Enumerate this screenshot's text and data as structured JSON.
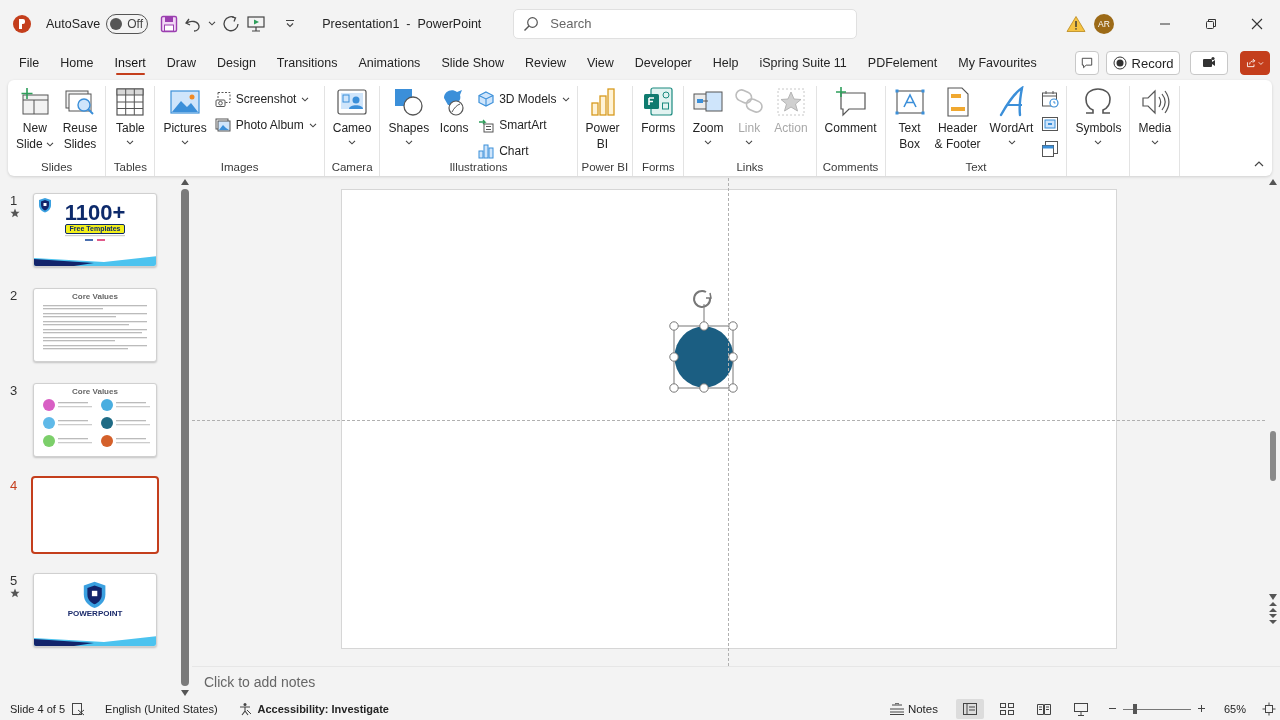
{
  "title_bar": {
    "autosave": {
      "label": "AutoSave",
      "state_text": "Off",
      "on": false
    },
    "document_title": "Presentation1  -  PowerPoint",
    "search": {
      "placeholder": "Search"
    },
    "account": {
      "initials": "AR"
    }
  },
  "tabs": [
    {
      "label": "File",
      "selected": false
    },
    {
      "label": "Home",
      "selected": false
    },
    {
      "label": "Insert",
      "selected": true
    },
    {
      "label": "Draw",
      "selected": false
    },
    {
      "label": "Design",
      "selected": false
    },
    {
      "label": "Transitions",
      "selected": false
    },
    {
      "label": "Animations",
      "selected": false
    },
    {
      "label": "Slide Show",
      "selected": false
    },
    {
      "label": "Review",
      "selected": false
    },
    {
      "label": "View",
      "selected": false
    },
    {
      "label": "Developer",
      "selected": false
    },
    {
      "label": "Help",
      "selected": false
    },
    {
      "label": "iSpring Suite 11",
      "selected": false
    },
    {
      "label": "PDFelement",
      "selected": false
    },
    {
      "label": "My Favourites",
      "selected": false
    }
  ],
  "tab_row_buttons": {
    "record": "Record"
  },
  "ribbon": {
    "groups": [
      {
        "label": "Slides",
        "items": [
          {
            "kind": "large",
            "label": "New\nSlide",
            "dropdown": true,
            "disabled": false
          },
          {
            "kind": "large",
            "label": "Reuse\nSlides",
            "dropdown": false,
            "disabled": false
          }
        ]
      },
      {
        "label": "Tables",
        "items": [
          {
            "kind": "large",
            "label": "Table",
            "dropdown": true,
            "disabled": false
          }
        ]
      },
      {
        "label": "Images",
        "items": [
          {
            "kind": "large",
            "label": "Pictures",
            "dropdown": true,
            "disabled": false
          },
          {
            "kind": "stack",
            "items": [
              {
                "kind": "small",
                "label": "Screenshot",
                "dropdown": true
              },
              {
                "kind": "small",
                "label": "Photo Album",
                "dropdown": true
              }
            ]
          }
        ]
      },
      {
        "label": "Camera",
        "items": [
          {
            "kind": "large",
            "label": "Cameo",
            "dropdown": true,
            "disabled": false
          }
        ]
      },
      {
        "label": "Illustrations",
        "items": [
          {
            "kind": "large",
            "label": "Shapes",
            "dropdown": true,
            "disabled": false
          },
          {
            "kind": "large",
            "label": "Icons",
            "dropdown": false,
            "disabled": false
          },
          {
            "kind": "stack",
            "items": [
              {
                "kind": "small",
                "label": "3D Models",
                "dropdown": true
              },
              {
                "kind": "small",
                "label": "SmartArt",
                "dropdown": false
              },
              {
                "kind": "small",
                "label": "Chart",
                "dropdown": false
              }
            ]
          }
        ]
      },
      {
        "label": "Power BI",
        "items": [
          {
            "kind": "large",
            "label": "Power\nBI",
            "dropdown": false,
            "disabled": false
          }
        ]
      },
      {
        "label": "Forms",
        "items": [
          {
            "kind": "large",
            "label": "Forms",
            "dropdown": false,
            "disabled": false
          }
        ]
      },
      {
        "label": "Links",
        "items": [
          {
            "kind": "large",
            "label": "Zoom",
            "dropdown": true,
            "disabled": false
          },
          {
            "kind": "large",
            "label": "Link",
            "dropdown": true,
            "disabled": true
          },
          {
            "kind": "large",
            "label": "Action",
            "dropdown": false,
            "disabled": true
          }
        ]
      },
      {
        "label": "Comments",
        "items": [
          {
            "kind": "large",
            "label": "Comment",
            "dropdown": false,
            "disabled": false
          }
        ]
      },
      {
        "label": "Text",
        "items": [
          {
            "kind": "large",
            "label": "Text\nBox",
            "dropdown": false,
            "disabled": false
          },
          {
            "kind": "large",
            "label": "Header\n& Footer",
            "dropdown": false,
            "disabled": false
          },
          {
            "kind": "large",
            "label": "WordArt",
            "dropdown": true,
            "disabled": false
          },
          {
            "kind": "stack",
            "items": [
              {
                "kind": "icon"
              },
              {
                "kind": "icon"
              },
              {
                "kind": "icon"
              }
            ]
          }
        ]
      },
      {
        "items": [
          {
            "kind": "large",
            "label": "Symbols",
            "dropdown": true,
            "disabled": false
          }
        ]
      },
      {
        "items": [
          {
            "kind": "large",
            "label": "Media",
            "dropdown": true,
            "disabled": false
          }
        ]
      }
    ]
  },
  "slides": [
    {
      "number": "1",
      "has_animation": true,
      "selected": false,
      "kind": "title",
      "texts": [
        "1100+",
        "Free Templates"
      ]
    },
    {
      "number": "2",
      "has_animation": false,
      "selected": false,
      "kind": "text",
      "texts": [
        "Core Values"
      ]
    },
    {
      "number": "3",
      "has_animation": false,
      "selected": false,
      "kind": "values",
      "texts": [
        "Core Values"
      ]
    },
    {
      "number": "4",
      "has_animation": false,
      "selected": true,
      "kind": "blank"
    },
    {
      "number": "5",
      "has_animation": true,
      "selected": false,
      "kind": "logo",
      "texts": [
        "POWERPOINT"
      ]
    }
  ],
  "slide": {
    "shapes": [
      {
        "kind": "ellipse",
        "selected": true
      }
    ]
  },
  "notes": {
    "placeholder": "Click to add notes"
  },
  "status_bar": {
    "slide_position": "Slide 4 of 5",
    "language": "English (United States)",
    "accessibility": "Accessibility: Investigate",
    "notes_button": "Notes",
    "views": [
      {
        "selected": true
      },
      {
        "selected": false
      },
      {
        "selected": false
      },
      {
        "selected": false
      }
    ],
    "zoom": {
      "level": 0.17,
      "reading": "65%"
    }
  }
}
